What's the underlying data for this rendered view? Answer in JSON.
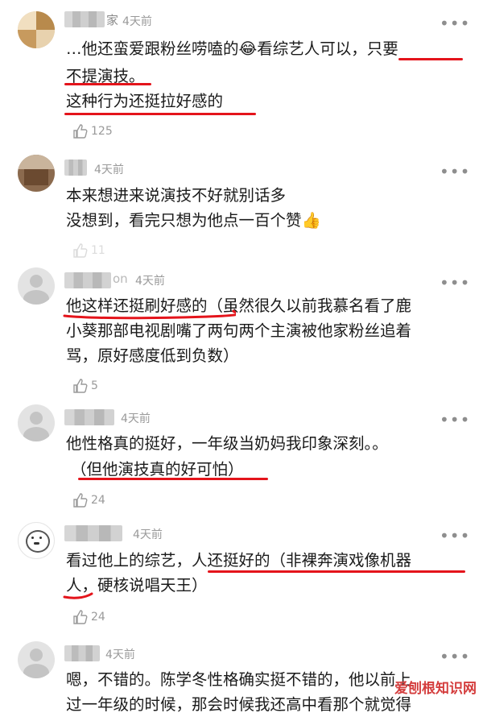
{
  "comments": [
    {
      "time": "4天前",
      "lines": [
        "…他还蛮爱跟粉丝唠嗑的😂看综艺人可以，只要",
        "不提演技。",
        "这种行为还挺拉好感的"
      ],
      "likes": "125"
    },
    {
      "time": "4天前",
      "lines": [
        "本来想进来说演技不好就别话多",
        "没想到，看完只想为他点一百个赞👍"
      ],
      "likes": "11"
    },
    {
      "name_suffix": "on",
      "time": "4天前",
      "lines": [
        "他这样还挺刷好感的（虽然很久以前我慕名看了鹿",
        "小葵那部电视剧嘴了两句两个主演被他家粉丝追着",
        "骂，原好感度低到负数）"
      ],
      "likes": "5"
    },
    {
      "time": "4天前",
      "lines": [
        "他性格真的挺好，一年级当奶妈我印象深刻。。",
        "（但他演技真的好可怕）"
      ],
      "likes": "24"
    },
    {
      "time": "4天前",
      "lines": [
        "看过他上的综艺，人还挺好的（非裸奔演戏像机器",
        "人，硬核说唱天王）"
      ],
      "likes": "24"
    },
    {
      "time": "4天前",
      "lines": [
        "嗯，不错的。陈学冬性格确实挺不错的，他以前上",
        "过一年级的时候，那会时候我还高中看那个就觉得"
      ],
      "likes": ""
    }
  ],
  "first_name_char": "家",
  "watermark": "爱刨根知识网",
  "colors": {
    "accent_red": "#e4141b",
    "meta_gray": "#9a9a9a"
  },
  "icons": {
    "like": "thumbs-up-icon",
    "more": "more-dots-icon"
  }
}
